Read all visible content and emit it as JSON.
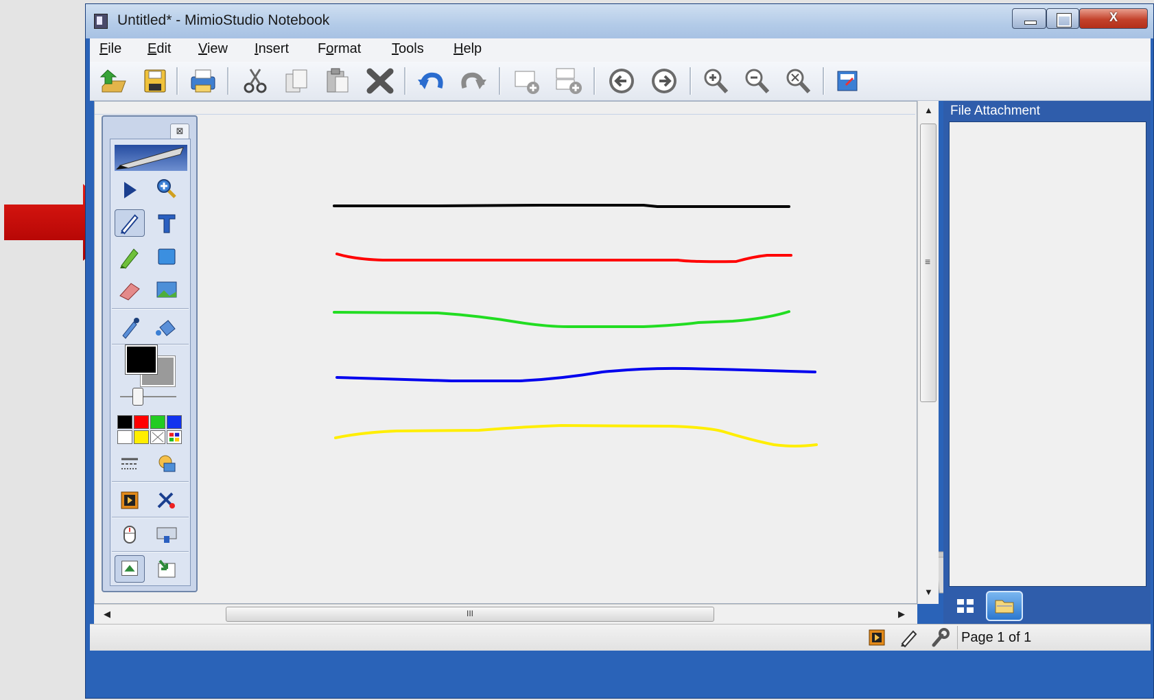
{
  "window": {
    "title": "Untitled* - MimioStudio Notebook",
    "close_glyph": "X"
  },
  "menu": {
    "items": [
      "File",
      "Edit",
      "View",
      "Insert",
      "Format",
      "Tools",
      "Help"
    ],
    "mnemonics": [
      "F",
      "E",
      "V",
      "I",
      "o",
      "T",
      "H"
    ]
  },
  "toolbar": {
    "buttons": [
      "open-icon",
      "save-icon",
      "print-icon",
      "cut-icon",
      "copy-icon",
      "paste-icon",
      "delete-icon",
      "undo-icon",
      "redo-icon",
      "new-page-icon",
      "duplicate-page-icon",
      "previous-page-icon",
      "next-page-icon",
      "zoom-in-icon",
      "zoom-out-icon",
      "zoom-fit-icon",
      "display-mode-icon"
    ]
  },
  "canvas": {
    "strokes": [
      {
        "color": "#000000"
      },
      {
        "color": "#ff0000"
      },
      {
        "color": "#22dd22"
      },
      {
        "color": "#0000ee"
      },
      {
        "color": "#ffee00"
      }
    ]
  },
  "right_panel": {
    "title": "File Attachment"
  },
  "hscroll": {
    "grip": "III"
  },
  "vscroll": {
    "grip": "≡"
  },
  "toolbox": {
    "close_glyph": "⊠",
    "current_color": "#000000",
    "palette": [
      "#000000",
      "#ff0000",
      "#22cc22",
      "#1133ee",
      "#ffffff",
      "#ffee00",
      "none",
      "more"
    ],
    "selected_tool": "pen-tool"
  },
  "statusbar": {
    "page_label": "Page 1 of 1"
  }
}
